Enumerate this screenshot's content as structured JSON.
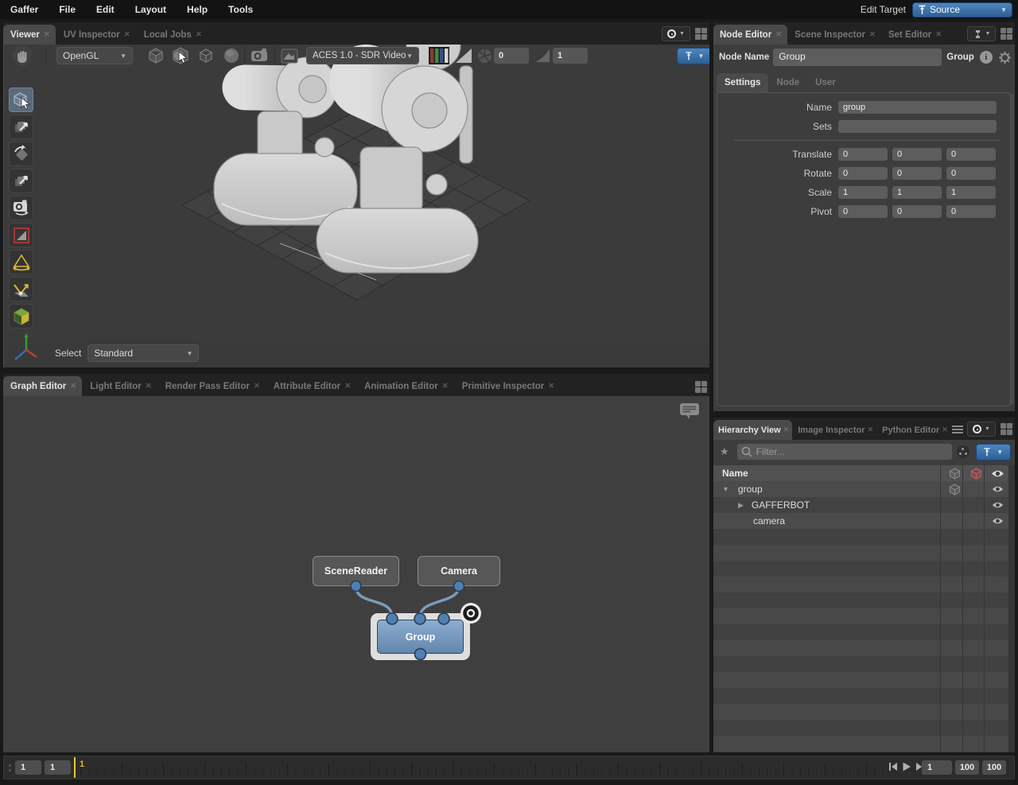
{
  "menubar": {
    "items": [
      "Gaffer",
      "File",
      "Edit",
      "Layout",
      "Help",
      "Tools"
    ],
    "edit_target_label": "Edit Target",
    "edit_target_value": "Source"
  },
  "viewer": {
    "tabs": [
      {
        "label": "Viewer"
      },
      {
        "label": "UV Inspector"
      },
      {
        "label": "Local Jobs"
      }
    ],
    "toolbar": {
      "renderer": "OpenGL",
      "display_transform": "ACES 1.0 - SDR Video",
      "exposure_value": "0",
      "gamma_value": "1",
      "icons": [
        "hand-icon",
        "shaded-cube-icon",
        "textured-cube-icon",
        "wireframe-cube-icon",
        "sphere-icon",
        "camera-icon",
        "image-icon",
        "color-channels-icon",
        "gamma-icon",
        "exposure-icon",
        "pin-dropdown"
      ]
    },
    "tools": [
      "select",
      "translate",
      "rotate",
      "scale",
      "camera",
      "crop-window",
      "light",
      "light-placement",
      "show-geometry"
    ],
    "select_label": "Select",
    "select_value": "Standard"
  },
  "graph_editor": {
    "tabs": [
      {
        "label": "Graph Editor"
      },
      {
        "label": "Light Editor"
      },
      {
        "label": "Render Pass Editor"
      },
      {
        "label": "Attribute Editor"
      },
      {
        "label": "Animation Editor"
      },
      {
        "label": "Primitive Inspector"
      }
    ],
    "nodes": [
      {
        "name": "SceneReader"
      },
      {
        "name": "Camera"
      },
      {
        "name": "Group",
        "selected": true,
        "focused": true
      }
    ]
  },
  "node_editor": {
    "tabs": [
      {
        "label": "Node Editor"
      },
      {
        "label": "Scene Inspector"
      },
      {
        "label": "Set Editor"
      }
    ],
    "node_name_label": "Node Name",
    "node_name_value": "Group",
    "node_type": "Group",
    "info_icon": "i",
    "sub_tabs": [
      {
        "label": "Settings"
      },
      {
        "label": "Node"
      },
      {
        "label": "User"
      }
    ],
    "form": {
      "name_label": "Name",
      "name_value": "group",
      "sets_label": "Sets",
      "sets_value": "",
      "rows": [
        {
          "label": "Translate",
          "values": [
            "0",
            "0",
            "0"
          ]
        },
        {
          "label": "Rotate",
          "values": [
            "0",
            "0",
            "0"
          ]
        },
        {
          "label": "Scale",
          "values": [
            "1",
            "1",
            "1"
          ]
        },
        {
          "label": "Pivot",
          "values": [
            "0",
            "0",
            "0"
          ]
        }
      ]
    }
  },
  "hierarchy": {
    "tabs": [
      {
        "label": "Hierarchy View"
      },
      {
        "label": "Image Inspector"
      },
      {
        "label": "Python Editor"
      }
    ],
    "filter_placeholder": "Filter...",
    "name_column": "Name",
    "rows": [
      {
        "name": "group",
        "depth": 0,
        "state": "expanded"
      },
      {
        "name": "GAFFERBOT",
        "depth": 1,
        "state": "collapsed"
      },
      {
        "name": "camera",
        "depth": 1,
        "state": "leaf"
      }
    ]
  },
  "timeline": {
    "range_start": "1",
    "current_frame": "1",
    "playhead_label": "1",
    "frame_field": "1",
    "range_end": "100",
    "end_frame": "100"
  },
  "colors": {
    "accent_blue": "#3c6f9f",
    "selected_node_blue": "#7ba0c8",
    "playhead_yellow": "#e3c93d"
  }
}
